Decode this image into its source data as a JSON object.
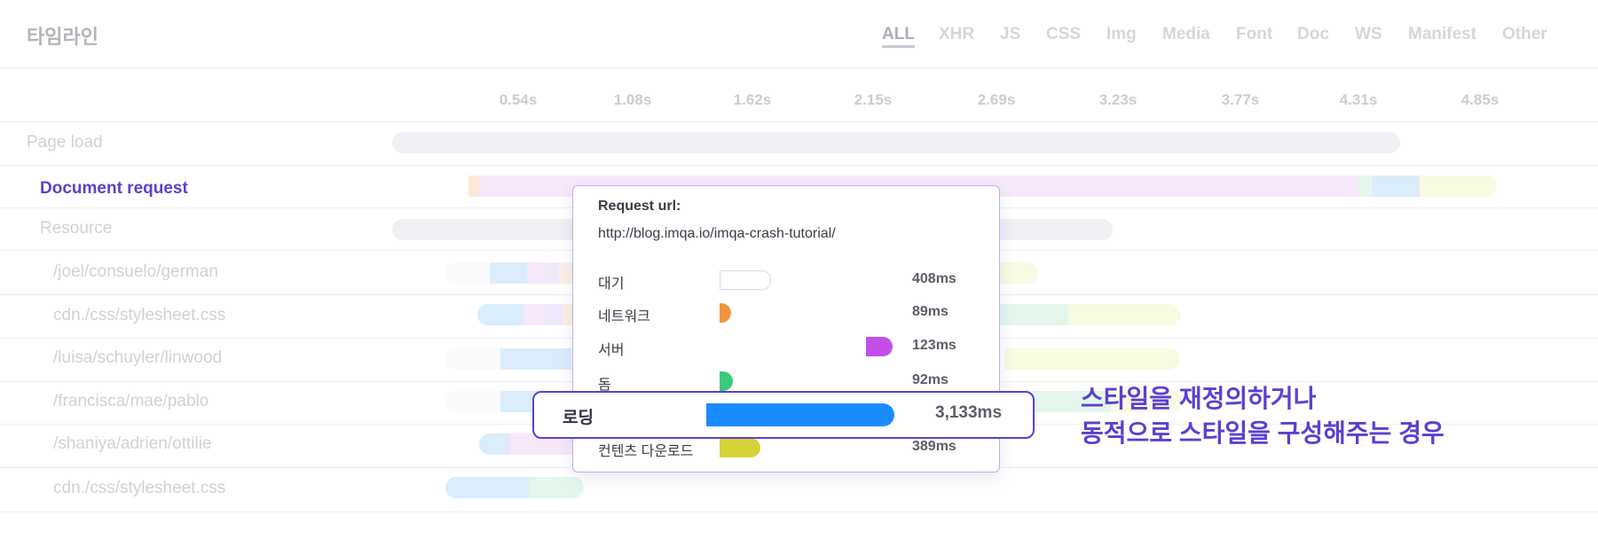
{
  "header": {
    "title": "타임라인"
  },
  "filter_tabs": [
    {
      "label": "ALL",
      "active": true
    },
    {
      "label": "XHR"
    },
    {
      "label": "JS"
    },
    {
      "label": "CSS"
    },
    {
      "label": "Img"
    },
    {
      "label": "Media"
    },
    {
      "label": "Font"
    },
    {
      "label": "Doc"
    },
    {
      "label": "WS"
    },
    {
      "label": "Manifest"
    },
    {
      "label": "Other"
    }
  ],
  "time_ticks": [
    "0.54s",
    "1.08s",
    "1.62s",
    "2.15s",
    "2.69s",
    "3.23s",
    "3.77s",
    "4.31s",
    "4.85s"
  ],
  "rows": [
    {
      "label": "Page load",
      "indent": 0
    },
    {
      "label": "Document request",
      "indent": 1,
      "selected": true
    },
    {
      "label": "Resource",
      "indent": 1
    },
    {
      "label": "/joel/consuelo/german",
      "indent": 2
    },
    {
      "label": "cdn./css/stylesheet.css",
      "indent": 2
    },
    {
      "label": "/luisa/schuyler/linwood",
      "indent": 2
    },
    {
      "label": "/francisca/mae/pablo",
      "indent": 2
    },
    {
      "label": "/shaniya/adrien/ottilie",
      "indent": 2
    },
    {
      "label": "cdn./css/stylesheet.css",
      "indent": 2
    }
  ],
  "popup": {
    "heading": "Request url:",
    "url": "http://blog.imqa.io/imqa-crash-tutorial/",
    "metrics": [
      {
        "label": "대기",
        "value": "408ms",
        "color": "#ffffff"
      },
      {
        "label": "네트워크",
        "value": "89ms",
        "color": "#f0953c"
      },
      {
        "label": "서버",
        "value": "123ms",
        "color": "#c44de8"
      },
      {
        "label": "돔",
        "value": "92ms",
        "color": "#3dc97e"
      },
      {
        "label": "로딩",
        "value": "3,133ms",
        "color": "#1a8cff"
      },
      {
        "label": "컨텐츠 다운로드",
        "value": "389ms",
        "color": "#d7d237"
      }
    ]
  },
  "annotation": {
    "line1": "스타일을 재정의하거나",
    "line2": "동적으로 스타일을 구성해주는 경우"
  }
}
